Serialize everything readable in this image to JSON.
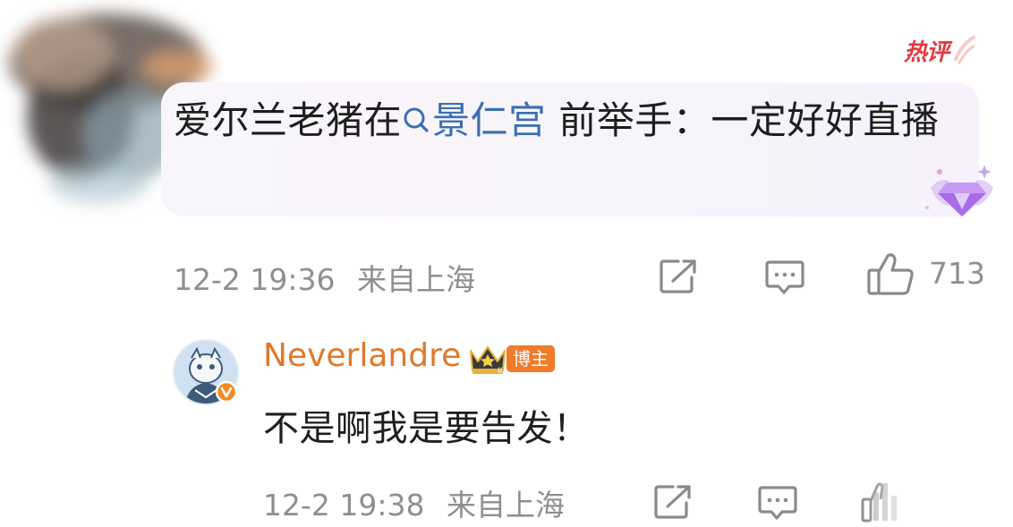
{
  "comment": {
    "text_before": "爱尔兰老猪在",
    "topic": "景仁宫",
    "text_after": " 前举手：一定好好直播",
    "badge": "热评",
    "time": "12-2 19:36",
    "location": "来自上海",
    "like_count": "713"
  },
  "reply": {
    "author": "Neverlandre",
    "author_badge": "博主",
    "text": "不是啊我是要告发！",
    "time": "12-2 19:38",
    "location": "来自上海"
  },
  "colors": {
    "accent_name": "#e0792b",
    "topic_link": "#3c6fb3",
    "hot_badge": "#e5393f",
    "meta_gray": "#8f8f8f"
  },
  "icons": {
    "share": "share-icon",
    "comment": "comment-icon",
    "like": "thumbs-up-icon",
    "search": "search-icon",
    "crown": "crown-icon",
    "verified": "verified-v-icon",
    "diamond": "diamond-badge-icon"
  }
}
